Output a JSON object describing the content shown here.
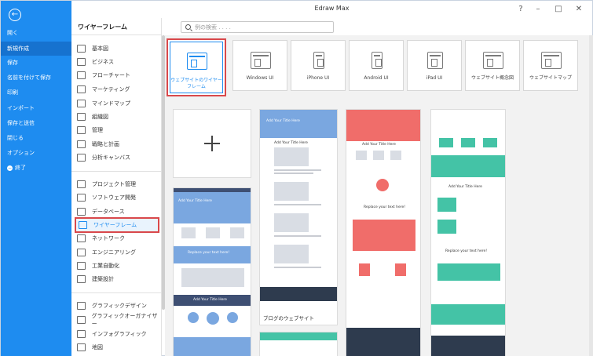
{
  "window": {
    "title": "Edraw Max"
  },
  "nav": {
    "items": [
      {
        "label": "開く"
      },
      {
        "label": "新規作成"
      },
      {
        "label": "保存"
      },
      {
        "label": "名前を付けて保存"
      },
      {
        "label": "印刷"
      },
      {
        "label": "インポート"
      },
      {
        "label": "保存と送信"
      },
      {
        "label": "閉じる"
      },
      {
        "label": "オプション"
      },
      {
        "label": "終了"
      }
    ]
  },
  "categories": {
    "heading": "ワイヤーフレーム",
    "group1": [
      {
        "label": "基本図",
        "icon": "basic-diagram-icon"
      },
      {
        "label": "ビジネス",
        "icon": "briefcase-icon"
      },
      {
        "label": "フローチャート",
        "icon": "flowchart-icon"
      },
      {
        "label": "マーケティング",
        "icon": "marketing-icon"
      },
      {
        "label": "マインドマップ",
        "icon": "mindmap-icon"
      },
      {
        "label": "組織図",
        "icon": "org-chart-icon"
      },
      {
        "label": "管理",
        "icon": "management-icon"
      },
      {
        "label": "戦略と計画",
        "icon": "strategy-icon"
      },
      {
        "label": "分析キャンバス",
        "icon": "canvas-icon"
      }
    ],
    "group2": [
      {
        "label": "プロジェクト管理",
        "icon": "project-icon"
      },
      {
        "label": "ソフトウェア開発",
        "icon": "software-icon"
      },
      {
        "label": "データベース",
        "icon": "database-icon"
      },
      {
        "label": "ワイヤーフレーム",
        "icon": "wireframe-icon"
      },
      {
        "label": "ネットワーク",
        "icon": "network-icon"
      },
      {
        "label": "エンジニアリング",
        "icon": "engineering-icon"
      },
      {
        "label": "工業自動化",
        "icon": "automation-icon"
      },
      {
        "label": "建築設計",
        "icon": "architecture-icon"
      }
    ],
    "group3": [
      {
        "label": "グラフィックデザイン",
        "icon": "graphic-design-icon"
      },
      {
        "label": "グラフィックオーガナイザー",
        "icon": "organizer-icon"
      },
      {
        "label": "インフォグラフィック",
        "icon": "infographic-icon"
      },
      {
        "label": "地図",
        "icon": "map-icon"
      }
    ]
  },
  "search": {
    "placeholder": "例の検索 . . . ."
  },
  "templates": [
    {
      "label": "ウェブサイトのワイヤーフレーム"
    },
    {
      "label": "Windows UI"
    },
    {
      "label": "iPhone UI"
    },
    {
      "label": "Android UI"
    },
    {
      "label": "iPad UI"
    },
    {
      "label": "ウェブサイト概念図"
    },
    {
      "label": "ウェブサイトマップ"
    }
  ],
  "gallery": {
    "blog_caption": "ブログのウェブサイト",
    "sample_texts": {
      "title_here": "Add Your Title Here",
      "title_here_short": "Add\nYour Title Here",
      "replace": "Replace your text here!"
    }
  },
  "colors": {
    "nav_bg": "#1e8cf0",
    "selection_border": "#d9484b",
    "accent": "#1e8cf0"
  }
}
